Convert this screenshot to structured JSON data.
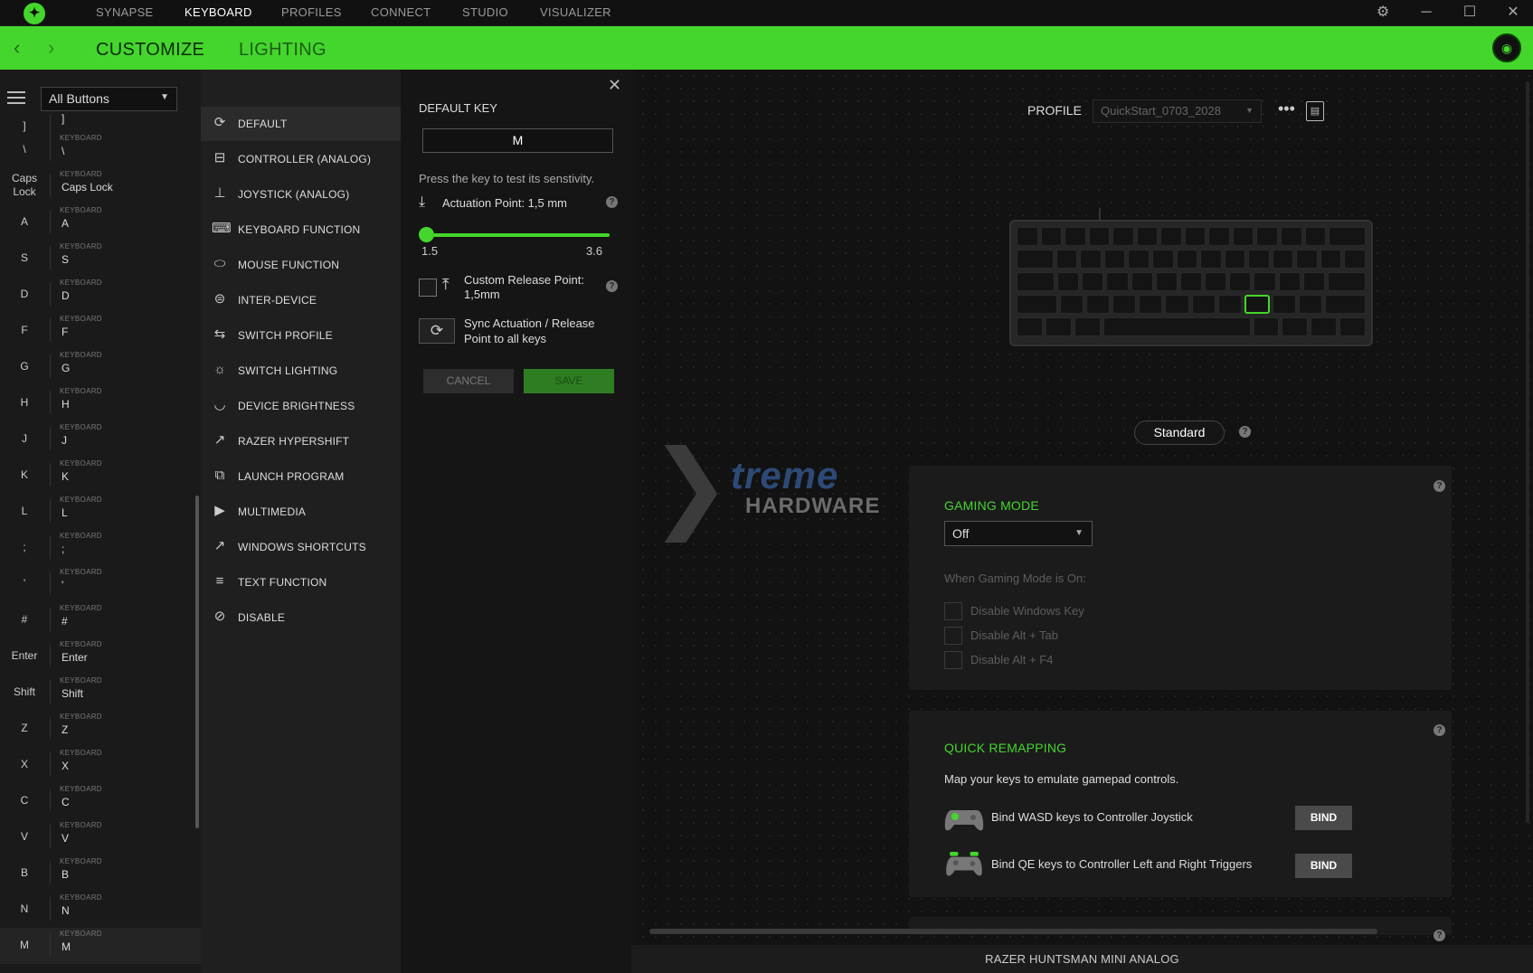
{
  "topnav": {
    "items": [
      "SYNAPSE",
      "KEYBOARD",
      "PROFILES",
      "CONNECT",
      "STUDIO",
      "VISUALIZER"
    ],
    "active": "KEYBOARD"
  },
  "window_controls": {
    "settings": "⚙",
    "minimize": "─",
    "maximize": "☐",
    "close": "✕"
  },
  "subnav": {
    "back": "‹",
    "forward": "›",
    "tabs": [
      "CUSTOMIZE",
      "LIGHTING"
    ],
    "active": "CUSTOMIZE"
  },
  "colors": {
    "accent": "#44d62c",
    "background": "#111111",
    "panel": "#1b1b1b"
  },
  "key_list": {
    "filter": "All Buttons",
    "rows": [
      {
        "key": "]",
        "category": "",
        "value": "]"
      },
      {
        "key": "\\",
        "category": "KEYBOARD",
        "value": "\\"
      },
      {
        "key": "Caps Lock",
        "category": "KEYBOARD",
        "value": "Caps Lock"
      },
      {
        "key": "A",
        "category": "KEYBOARD",
        "value": "A"
      },
      {
        "key": "S",
        "category": "KEYBOARD",
        "value": "S"
      },
      {
        "key": "D",
        "category": "KEYBOARD",
        "value": "D"
      },
      {
        "key": "F",
        "category": "KEYBOARD",
        "value": "F"
      },
      {
        "key": "G",
        "category": "KEYBOARD",
        "value": "G"
      },
      {
        "key": "H",
        "category": "KEYBOARD",
        "value": "H"
      },
      {
        "key": "J",
        "category": "KEYBOARD",
        "value": "J"
      },
      {
        "key": "K",
        "category": "KEYBOARD",
        "value": "K"
      },
      {
        "key": "L",
        "category": "KEYBOARD",
        "value": "L"
      },
      {
        "key": ";",
        "category": "KEYBOARD",
        "value": ";"
      },
      {
        "key": "'",
        "category": "KEYBOARD",
        "value": "'"
      },
      {
        "key": "#",
        "category": "KEYBOARD",
        "value": "#"
      },
      {
        "key": "Enter",
        "category": "KEYBOARD",
        "value": "Enter"
      },
      {
        "key": "Shift",
        "category": "KEYBOARD",
        "value": "Shift"
      },
      {
        "key": "Z",
        "category": "KEYBOARD",
        "value": "Z"
      },
      {
        "key": "X",
        "category": "KEYBOARD",
        "value": "X"
      },
      {
        "key": "C",
        "category": "KEYBOARD",
        "value": "C"
      },
      {
        "key": "V",
        "category": "KEYBOARD",
        "value": "V"
      },
      {
        "key": "B",
        "category": "KEYBOARD",
        "value": "B"
      },
      {
        "key": "N",
        "category": "KEYBOARD",
        "value": "N"
      },
      {
        "key": "M",
        "category": "KEYBOARD",
        "value": "M"
      }
    ],
    "selected": "M"
  },
  "functions": {
    "items": [
      {
        "label": "DEFAULT",
        "icon": "refresh-icon"
      },
      {
        "label": "CONTROLLER (ANALOG)",
        "icon": "gamepad-icon"
      },
      {
        "label": "JOYSTICK (ANALOG)",
        "icon": "joystick-icon"
      },
      {
        "label": "KEYBOARD FUNCTION",
        "icon": "keyboard-icon"
      },
      {
        "label": "MOUSE FUNCTION",
        "icon": "mouse-icon"
      },
      {
        "label": "INTER-DEVICE",
        "icon": "inter-device-icon"
      },
      {
        "label": "SWITCH PROFILE",
        "icon": "swap-icon"
      },
      {
        "label": "SWITCH LIGHTING",
        "icon": "sun-icon"
      },
      {
        "label": "DEVICE BRIGHTNESS",
        "icon": "brightness-icon"
      },
      {
        "label": "RAZER HYPERSHIFT",
        "icon": "hypershift-icon"
      },
      {
        "label": "LAUNCH PROGRAM",
        "icon": "launch-icon"
      },
      {
        "label": "MULTIMEDIA",
        "icon": "play-icon"
      },
      {
        "label": "WINDOWS SHORTCUTS",
        "icon": "shortcut-icon"
      },
      {
        "label": "TEXT FUNCTION",
        "icon": "text-icon"
      },
      {
        "label": "DISABLE",
        "icon": "disable-icon"
      }
    ],
    "selected": "DEFAULT"
  },
  "config": {
    "title": "DEFAULT KEY",
    "key_value": "M",
    "hint": "Press the key to test its senstivity.",
    "actuation_label": "Actuation Point: 1,5 mm",
    "slider": {
      "min": "1.5",
      "max": "3.6",
      "value": 1.5
    },
    "release_label": "Custom Release Point: 1,5mm",
    "release_checked": false,
    "sync_label": "Sync Actuation / Release Point to all keys",
    "cancel": "CANCEL",
    "save": "SAVE"
  },
  "profile": {
    "label": "PROFILE",
    "value": "QuickStart_0703_2028",
    "more": "•••"
  },
  "keyboard_mode": "Standard",
  "watermark": {
    "line1": "treme",
    "line2": "HARDWARE"
  },
  "gaming_mode": {
    "title": "GAMING MODE",
    "value": "Off",
    "subtitle": "When Gaming Mode is On:",
    "options": [
      {
        "label": "Disable Windows Key",
        "checked": false
      },
      {
        "label": "Disable Alt + Tab",
        "checked": false
      },
      {
        "label": "Disable Alt + F4",
        "checked": false
      }
    ]
  },
  "quick_remapping": {
    "title": "QUICK REMAPPING",
    "subtitle": "Map your keys to emulate gamepad controls.",
    "items": [
      {
        "label": "Bind WASD keys to Controller Joystick",
        "button": "BIND"
      },
      {
        "label": "Bind QE keys to Controller Left and Right Triggers",
        "button": "BIND"
      }
    ]
  },
  "device_name": "RAZER HUNTSMAN MINI ANALOG"
}
